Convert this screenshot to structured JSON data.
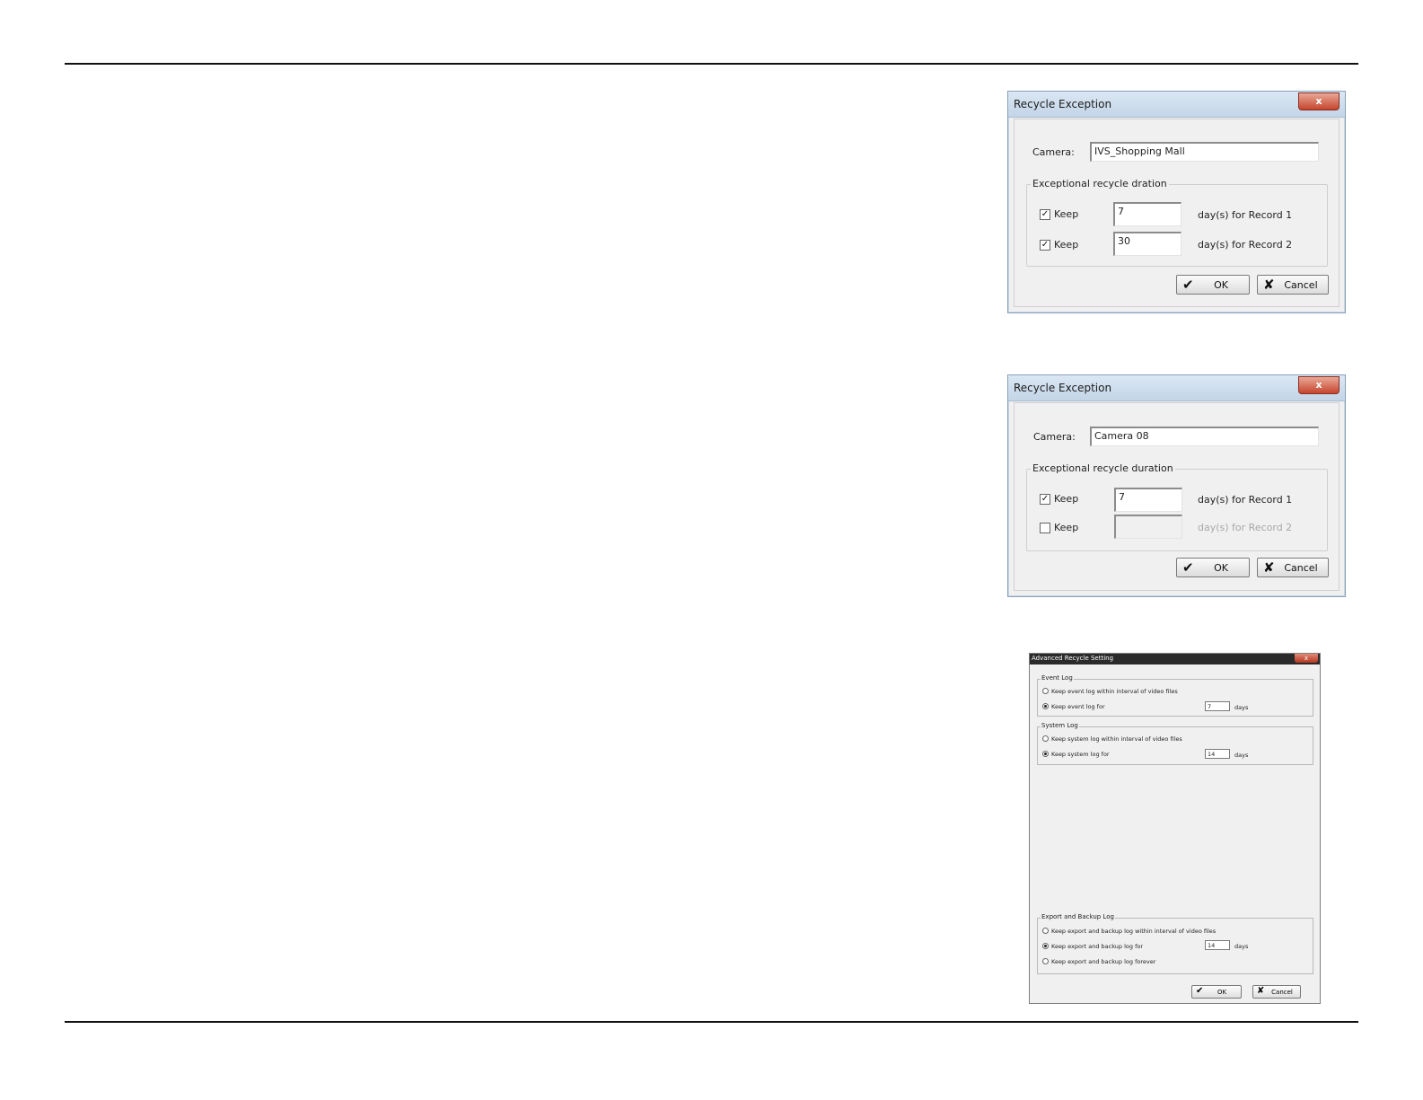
{
  "dialog1": {
    "title": "Recycle Exception",
    "close_label": "x",
    "camera_label": "Camera:",
    "camera_value": "IVS_Shopping Mall",
    "group_title": "Exceptional recycle dration",
    "rows": [
      {
        "checked": true,
        "keep_label": "Keep",
        "days": "7",
        "suffix": "day(s) for Record 1"
      },
      {
        "checked": true,
        "keep_label": "Keep",
        "days": "30",
        "suffix": "day(s) for Record 2"
      }
    ],
    "ok_label": "OK",
    "cancel_label": "Cancel"
  },
  "dialog2": {
    "title": "Recycle Exception",
    "close_label": "x",
    "camera_label": "Camera:",
    "camera_value": "Camera 08",
    "group_title": "Exceptional recycle duration",
    "rows": [
      {
        "checked": true,
        "keep_label": "Keep",
        "days": "7",
        "suffix": "day(s) for Record 1"
      },
      {
        "checked": false,
        "keep_label": "Keep",
        "days": "",
        "suffix": "day(s) for Record 2"
      }
    ],
    "ok_label": "OK",
    "cancel_label": "Cancel"
  },
  "advanced": {
    "title": "Advanced Recycle Setting",
    "close_label": "x",
    "event_log": {
      "title": "Event Log",
      "option_interval": "Keep event log within interval of video files",
      "option_for": "Keep event log for",
      "days": "7",
      "unit": "days"
    },
    "system_log": {
      "title": "System Log",
      "option_interval": "Keep system log within interval of video files",
      "option_for": "Keep system log for",
      "days": "14",
      "unit": "days"
    },
    "export_log": {
      "title": "Export and Backup Log",
      "option_interval": "Keep export and backup log within interval of video files",
      "option_for": "Keep export and backup log for",
      "option_forever": "Keep export and backup log forever",
      "days": "14",
      "unit": "days"
    },
    "ok_label": "OK",
    "cancel_label": "Cancel"
  },
  "icons": {
    "check": "✔",
    "cross": "✘",
    "checkmark_box": "✓"
  }
}
